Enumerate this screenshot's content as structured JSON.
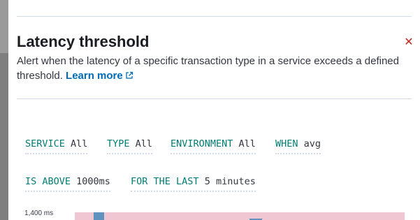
{
  "flyout": {
    "title": "Latency threshold",
    "description": "Alert when the latency of a specific transaction type in a service exceeds a defined threshold.",
    "learn_more_label": "Learn more"
  },
  "expressions": [
    {
      "keyword": "SERVICE",
      "value": "All"
    },
    {
      "keyword": "TYPE",
      "value": "All"
    },
    {
      "keyword": "ENVIRONMENT",
      "value": "All"
    },
    {
      "keyword": "WHEN",
      "value": "avg"
    },
    {
      "keyword": "IS ABOVE",
      "value": "1000ms"
    },
    {
      "keyword": "FOR THE LAST",
      "value": "5 minutes"
    }
  ],
  "chart_data": {
    "type": "bar",
    "y_tick_labels": [
      "1,400 ms"
    ]
  },
  "colors": {
    "close": "#bd271e",
    "link": "#006bb8",
    "keyword": "#017d73",
    "threshold_band": "#f1c6d3",
    "bar": "#6092c0"
  },
  "icons": {
    "close": "cross-icon",
    "external_link": "external-link-icon"
  }
}
